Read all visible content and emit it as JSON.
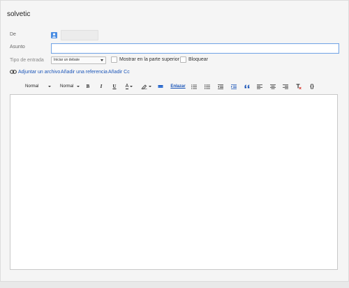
{
  "group": {
    "name": "solvetic"
  },
  "form": {
    "from_label": "De",
    "subject_label": "Asunto",
    "subject_value": "",
    "post_type_label": "Tipo de entrada",
    "post_type_value": "Iniciar un debate",
    "pin_label": "Mostrar en la parte superior",
    "pin_checked": false,
    "lock_label": "Bloquear",
    "lock_checked": false
  },
  "links": {
    "attach": "Adjuntar un archivo",
    "reference": "Añadir una referencia",
    "add_cc": "Añadir Cc"
  },
  "toolbar": {
    "font_family": "Normal",
    "font_size": "Normal",
    "bold": "B",
    "italic": "I",
    "underline": "U",
    "text_color": "A",
    "link": "Enlazar",
    "code": "{}"
  },
  "icons": {
    "avatar": "person-icon",
    "paperclip": "link-icon",
    "highlight": "highlighter-icon",
    "image": "image-icon",
    "numbered_list": "numbered-list-icon",
    "bulleted_list": "bulleted-list-icon",
    "indent_less": "indent-less-icon",
    "indent_more": "indent-more-icon",
    "quote": "quote-icon",
    "align_left": "align-left-icon",
    "align_center": "align-center-icon",
    "align_right": "align-right-icon",
    "clear_format": "clear-formatting-icon"
  },
  "colors": {
    "link": "#1a55b8",
    "avatar": "#4a8de3",
    "focus_border": "#76a7e6"
  }
}
